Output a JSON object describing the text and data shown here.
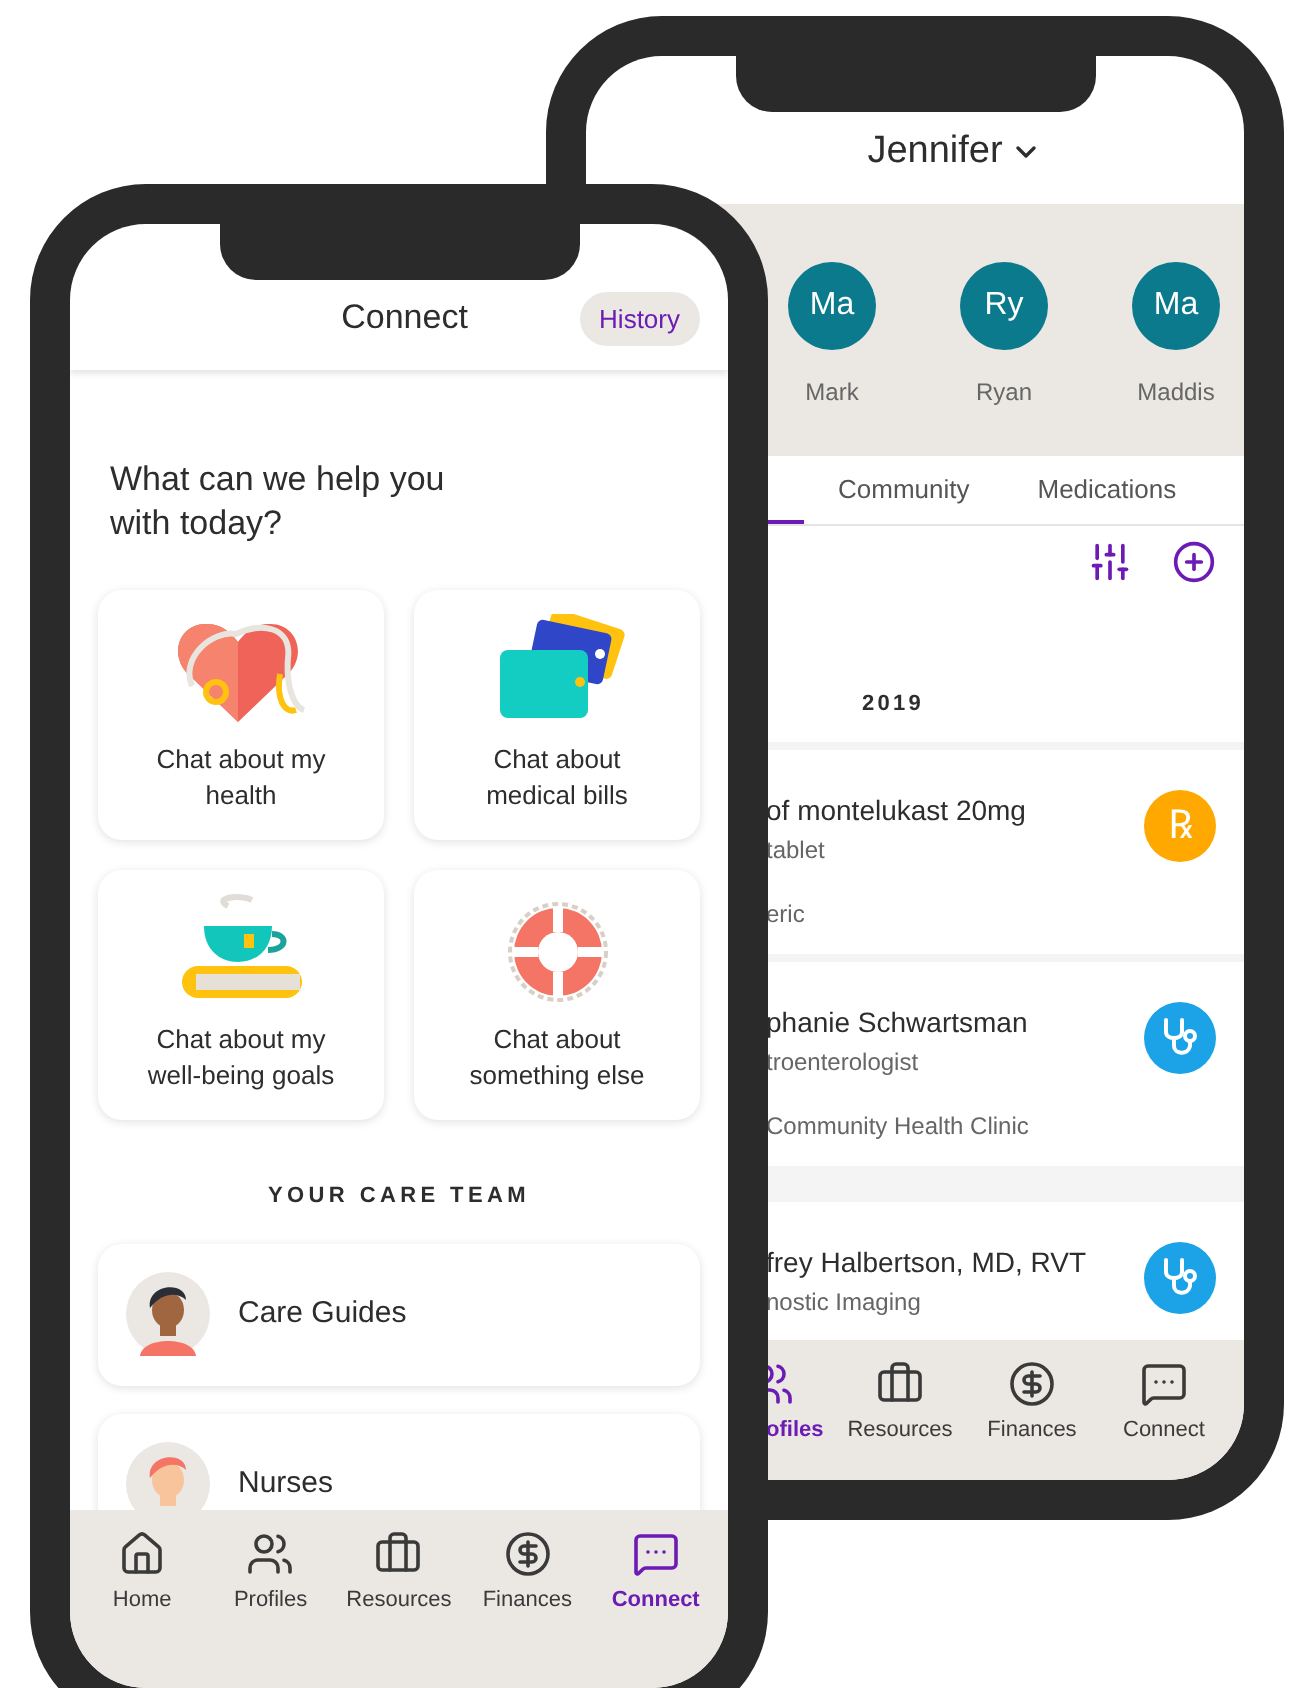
{
  "back_phone": {
    "profile_switcher": "Jennifer",
    "profiles": [
      {
        "initials": "Ma",
        "name": "Mark"
      },
      {
        "initials": "Ry",
        "name": "Ryan"
      },
      {
        "initials": "Ma",
        "name": "Maddis"
      }
    ],
    "tabs": [
      {
        "label": "Community",
        "selected": false
      },
      {
        "label": "Medications",
        "selected": false
      }
    ],
    "year": "2019",
    "records": [
      {
        "kind": "prescription",
        "badge": "℞",
        "title": "of montelukast 20mg",
        "subtitle": "tablet",
        "detail": "eric"
      },
      {
        "kind": "provider",
        "title": "phanie Schwartsman",
        "subtitle": "troenterologist",
        "detail": "Community Health Clinic"
      },
      {
        "kind": "provider",
        "title": "frey Halbertson, MD, RVT",
        "subtitle": "nostic Imaging"
      }
    ],
    "nav": [
      {
        "kind": "profiles",
        "label": "ofiles",
        "selected": true
      },
      {
        "kind": "resources",
        "label": "Resources",
        "selected": false
      },
      {
        "kind": "finances",
        "label": "Finances",
        "selected": false
      },
      {
        "kind": "connect",
        "label": "Connect",
        "selected": false
      }
    ]
  },
  "front_phone": {
    "title": "Connect",
    "history_button": "History",
    "prompt": "What can we help you with today?",
    "topics": [
      {
        "kind": "health",
        "label": "Chat about my health"
      },
      {
        "kind": "bills",
        "label": "Chat about medical bills"
      },
      {
        "kind": "wellbeing",
        "label": "Chat about my well-being goals"
      },
      {
        "kind": "other",
        "label": "Chat about something else"
      }
    ],
    "care_team_heading": "YOUR CARE TEAM",
    "care_team": [
      {
        "kind": "guide",
        "label": "Care Guides"
      },
      {
        "kind": "nurse",
        "label": "Nurses"
      }
    ],
    "nav": [
      {
        "kind": "home",
        "label": "Home",
        "selected": false
      },
      {
        "kind": "profiles",
        "label": "Profiles",
        "selected": false
      },
      {
        "kind": "resources",
        "label": "Resources",
        "selected": false
      },
      {
        "kind": "finances",
        "label": "Finances",
        "selected": false
      },
      {
        "kind": "connect",
        "label": "Connect",
        "selected": true
      }
    ]
  }
}
